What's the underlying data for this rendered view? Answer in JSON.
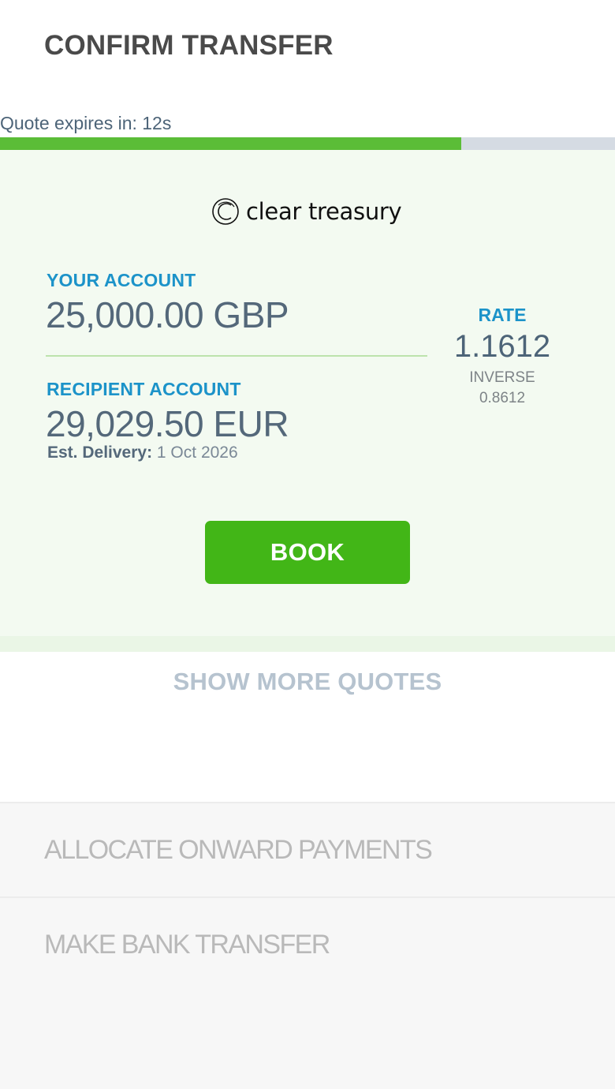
{
  "header": {
    "title": "CONFIRM TRANSFER"
  },
  "quote_timer": {
    "text": "Quote expires in: 12s",
    "progress_fraction": 0.75,
    "fill_color": "#5bbd37",
    "track_color": "#d5dbe3"
  },
  "brand": {
    "name": "clear treasury",
    "icon": "clear-treasury-logo-icon"
  },
  "your_account": {
    "label": "YOUR ACCOUNT",
    "amount": "25,000.00 GBP"
  },
  "recipient_account": {
    "label": "RECIPIENT ACCOUNT",
    "amount": "29,029.50 EUR",
    "delivery_label": "Est. Delivery:",
    "delivery_value": "1 Oct 2026"
  },
  "rate": {
    "label": "RATE",
    "value": "1.1612",
    "inverse_label": "INVERSE",
    "inverse_value": "0.8612"
  },
  "actions": {
    "book_label": "BOOK",
    "show_more_label": "SHOW MORE QUOTES"
  },
  "steps": [
    {
      "label": "ALLOCATE ONWARD PAYMENTS"
    },
    {
      "label": "MAKE BANK TRANSFER"
    }
  ],
  "colors": {
    "accent_blue": "#1c93c9",
    "book_green": "#42b617",
    "panel_bg": "#f3faf1"
  }
}
